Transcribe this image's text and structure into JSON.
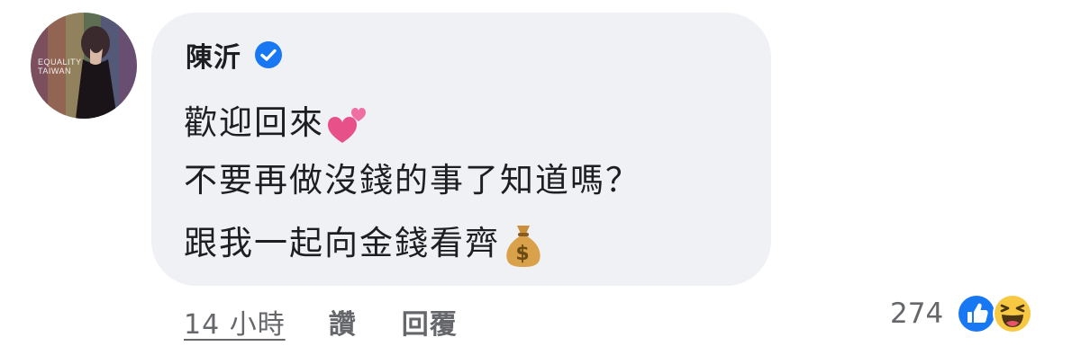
{
  "comment": {
    "author": "陳沂",
    "verified": true,
    "lines": [
      "歡迎回來",
      "不要再做沒錢的事了知道嗎？",
      "跟我一起向金錢看齊"
    ],
    "line1_emoji": "two-hearts-icon",
    "line3_emoji": "money-bag-icon",
    "avatar_text": [
      "EQUALITY",
      "TAIWAN"
    ]
  },
  "actions": {
    "timestamp": "14 小時",
    "like_label": "讚",
    "reply_label": "回覆"
  },
  "reactions": {
    "count": "274",
    "icons": [
      "like-reaction-icon",
      "haha-reaction-icon"
    ]
  },
  "colors": {
    "bubble": "#eff1f4",
    "text": "#1c1e21",
    "secondary": "#65676b",
    "verified_blue": "#1877f2"
  }
}
